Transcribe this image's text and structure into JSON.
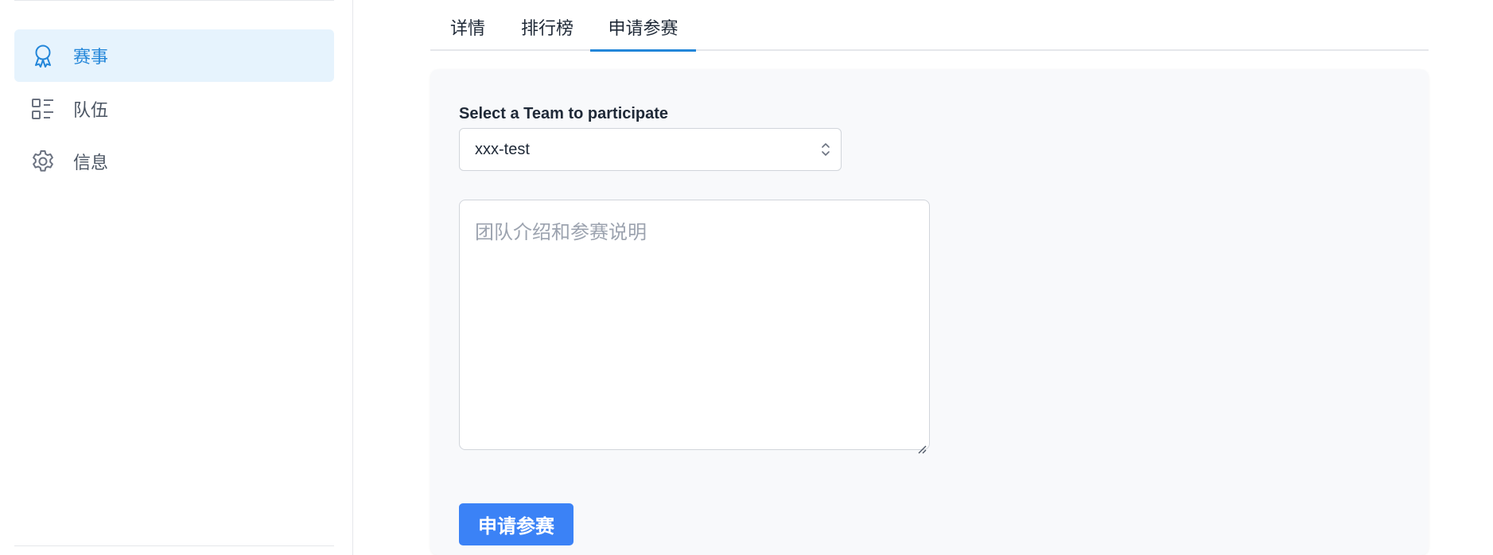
{
  "sidebar": {
    "items": [
      {
        "label": "赛事",
        "icon": "award-ribbon-icon",
        "active": true
      },
      {
        "label": "队伍",
        "icon": "list-icon",
        "active": false
      },
      {
        "label": "信息",
        "icon": "gear-icon",
        "active": false
      }
    ]
  },
  "tabs": [
    {
      "label": "详情",
      "active": false
    },
    {
      "label": "排行榜",
      "active": false
    },
    {
      "label": "申请参赛",
      "active": true
    }
  ],
  "form": {
    "select_label": "Select a Team to participate",
    "select_value": "xxx-test",
    "textarea_placeholder": "团队介绍和参赛说明",
    "submit_label": "申请参赛"
  },
  "colors": {
    "accent": "#2386d9",
    "active_bg": "#e6f3fd",
    "button": "#3b82f6",
    "card_bg": "#f8f9fb"
  }
}
